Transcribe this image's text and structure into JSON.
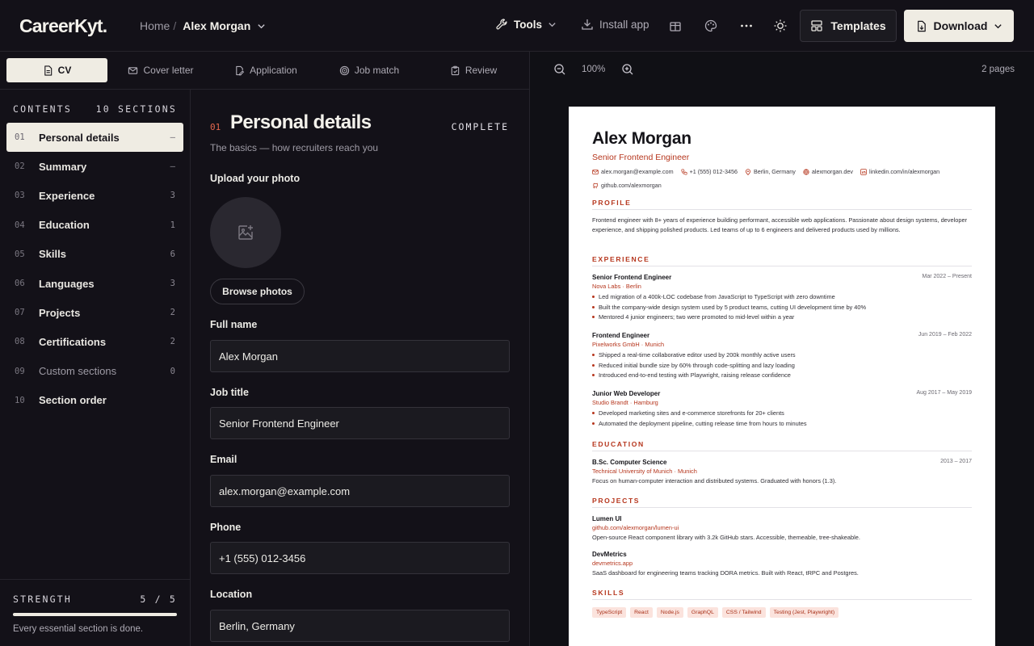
{
  "app": {
    "logo": "CareerKyt."
  },
  "breadcrumb": {
    "home": "Home",
    "separator": "/",
    "current": "Alex Morgan"
  },
  "toolbar": {
    "tools_label": "Tools",
    "install_label": "Install app",
    "templates_label": "Templates",
    "download_label": "Download"
  },
  "tabs": [
    {
      "label": "CV",
      "active": true
    },
    {
      "label": "Cover letter"
    },
    {
      "label": "Application"
    },
    {
      "label": "Job match"
    },
    {
      "label": "Review"
    }
  ],
  "sidebar": {
    "heading": "CONTENTS",
    "section_count": "10 SECTIONS",
    "items": [
      {
        "num": "01",
        "label": "Personal details",
        "count": "–",
        "active": true
      },
      {
        "num": "02",
        "label": "Summary",
        "count": "–"
      },
      {
        "num": "03",
        "label": "Experience",
        "count": "3"
      },
      {
        "num": "04",
        "label": "Education",
        "count": "1"
      },
      {
        "num": "05",
        "label": "Skills",
        "count": "6"
      },
      {
        "num": "06",
        "label": "Languages",
        "count": "3"
      },
      {
        "num": "07",
        "label": "Projects",
        "count": "2"
      },
      {
        "num": "08",
        "label": "Certifications",
        "count": "2"
      },
      {
        "num": "09",
        "label": "Custom sections",
        "count": "0",
        "muted": true
      },
      {
        "num": "10",
        "label": "Section order",
        "count": ""
      }
    ],
    "strength": {
      "label": "STRENGTH",
      "value": "5 / 5",
      "fraction": 1.0,
      "message": "Every essential section is done."
    }
  },
  "form": {
    "section_num": "01",
    "title": "Personal details",
    "status": "COMPLETE",
    "subtitle": "The basics — how recruiters reach you",
    "upload_label": "Upload your photo",
    "browse_label": "Browse photos",
    "fields": {
      "full_name": {
        "label": "Full name",
        "value": "Alex Morgan"
      },
      "job_title": {
        "label": "Job title",
        "value": "Senior Frontend Engineer"
      },
      "email": {
        "label": "Email",
        "value": "alex.morgan@example.com"
      },
      "phone": {
        "label": "Phone",
        "value": "+1 (555) 012-3456"
      },
      "location": {
        "label": "Location",
        "value": "Berlin, Germany"
      }
    }
  },
  "preview": {
    "zoom": "100%",
    "pages": "2 pages",
    "resume": {
      "name": "Alex Morgan",
      "role": "Senior Frontend Engineer",
      "contacts": {
        "email": "alex.morgan@example.com",
        "phone": "+1 (555) 012-3456",
        "location": "Berlin, Germany",
        "website": "alexmorgan.dev",
        "linkedin": "linkedin.com/in/alexmorgan",
        "github": "github.com/alexmorgan"
      },
      "profile_heading": "PROFILE",
      "profile_text": "Frontend engineer with 8+ years of experience building performant, accessible web applications. Passionate about design systems, developer experience, and shipping polished products. Led teams of up to 6 engineers and delivered products used by millions.",
      "experience_heading": "EXPERIENCE",
      "experience": [
        {
          "title": "Senior Frontend Engineer",
          "date": "Mar 2022 – Present",
          "company": "Nova Labs",
          "city": "Berlin",
          "bullets": [
            "Led migration of a 400k-LOC codebase from JavaScript to TypeScript with zero downtime",
            "Built the company-wide design system used by 5 product teams, cutting UI development time by 40%",
            "Mentored 4 junior engineers; two were promoted to mid-level within a year"
          ]
        },
        {
          "title": "Frontend Engineer",
          "date": "Jun 2019 – Feb 2022",
          "company": "Pixelworks GmbH",
          "city": "Munich",
          "bullets": [
            "Shipped a real-time collaborative editor used by 200k monthly active users",
            "Reduced initial bundle size by 60% through code-splitting and lazy loading",
            "Introduced end-to-end testing with Playwright, raising release confidence"
          ]
        },
        {
          "title": "Junior Web Developer",
          "date": "Aug 2017 – May 2019",
          "company": "Studio Brandt",
          "city": "Hamburg",
          "bullets": [
            "Developed marketing sites and e-commerce storefronts for 20+ clients",
            "Automated the deployment pipeline, cutting release time from hours to minutes"
          ]
        }
      ],
      "education_heading": "EDUCATION",
      "education": {
        "degree": "B.Sc. Computer Science",
        "date": "2013 – 2017",
        "school": "Technical University of Munich",
        "city": "Munich",
        "description": "Focus on human-computer interaction and distributed systems. Graduated with honors (1.3)."
      },
      "projects_heading": "PROJECTS",
      "projects": [
        {
          "title": "Lumen UI",
          "link": "github.com/alexmorgan/lumen-ui",
          "description": "Open-source React component library with 3.2k GitHub stars. Accessible, themeable, tree-shakeable."
        },
        {
          "title": "DevMetrics",
          "link": "devmetrics.app",
          "description": "SaaS dashboard for engineering teams tracking DORA metrics. Built with React, tRPC and Postgres."
        }
      ],
      "skills_heading": "SKILLS",
      "skills": [
        "TypeScript",
        "React",
        "Node.js",
        "GraphQL",
        "CSS / Tailwind",
        "Testing (Jest, Playwright)"
      ]
    }
  },
  "colors": {
    "accent": "#b6361d",
    "highlight": "#e2674e",
    "cream": "#efece3",
    "background": "#131118"
  }
}
